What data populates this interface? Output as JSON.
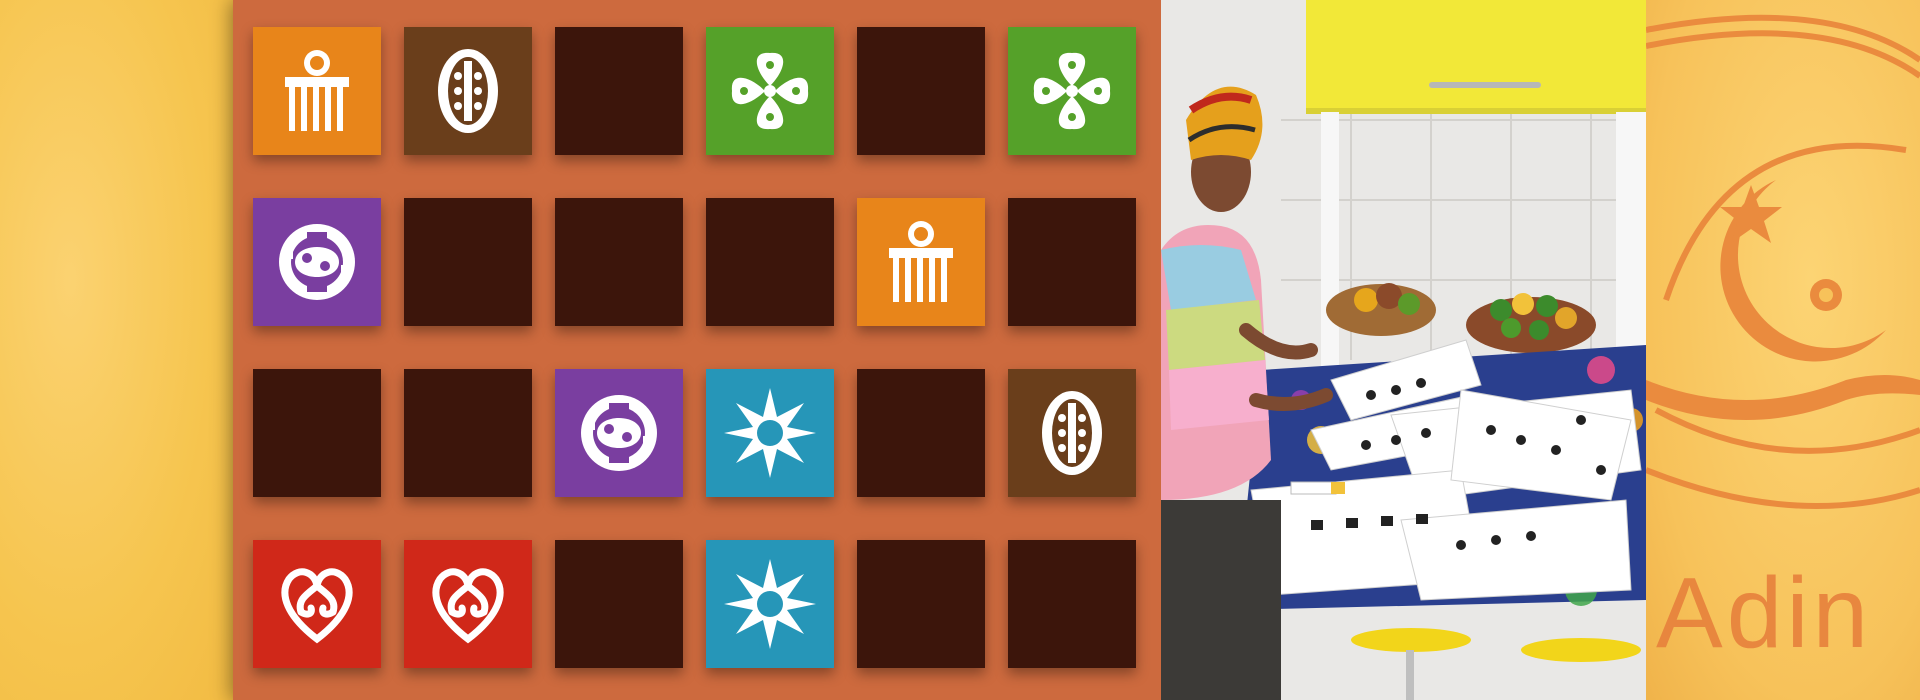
{
  "colors": {
    "board": "#cd6a3e",
    "facedown": "#3c150b",
    "symbol": "#ffffff"
  },
  "symbol_colors": {
    "comb-icon": "#e8851a",
    "drum-icon": "#6a3e1b",
    "clover-icon": "#55a129",
    "gye-nyame-icon": "#7a3ea0",
    "star-sun-icon": "#2696b8",
    "sankofa-heart-icon": "#d02819"
  },
  "grid": {
    "rows": 4,
    "cols": 6,
    "cards": [
      {
        "state": "revealed",
        "symbol": "comb-icon"
      },
      {
        "state": "revealed",
        "symbol": "drum-icon"
      },
      {
        "state": "hidden",
        "symbol": ""
      },
      {
        "state": "revealed",
        "symbol": "clover-icon"
      },
      {
        "state": "hidden",
        "symbol": ""
      },
      {
        "state": "revealed",
        "symbol": "clover-icon"
      },
      {
        "state": "revealed",
        "symbol": "gye-nyame-icon"
      },
      {
        "state": "hidden",
        "symbol": ""
      },
      {
        "state": "hidden",
        "symbol": ""
      },
      {
        "state": "hidden",
        "symbol": ""
      },
      {
        "state": "revealed",
        "symbol": "comb-icon"
      },
      {
        "state": "hidden",
        "symbol": ""
      },
      {
        "state": "hidden",
        "symbol": ""
      },
      {
        "state": "hidden",
        "symbol": ""
      },
      {
        "state": "revealed",
        "symbol": "gye-nyame-icon"
      },
      {
        "state": "revealed",
        "symbol": "star-sun-icon"
      },
      {
        "state": "hidden",
        "symbol": ""
      },
      {
        "state": "revealed",
        "symbol": "drum-icon"
      },
      {
        "state": "revealed",
        "symbol": "sankofa-heart-icon"
      },
      {
        "state": "revealed",
        "symbol": "sankofa-heart-icon"
      },
      {
        "state": "hidden",
        "symbol": ""
      },
      {
        "state": "revealed",
        "symbol": "star-sun-icon"
      },
      {
        "state": "hidden",
        "symbol": ""
      },
      {
        "state": "hidden",
        "symbol": ""
      }
    ]
  },
  "banner": {
    "brand_text": "Adin"
  }
}
